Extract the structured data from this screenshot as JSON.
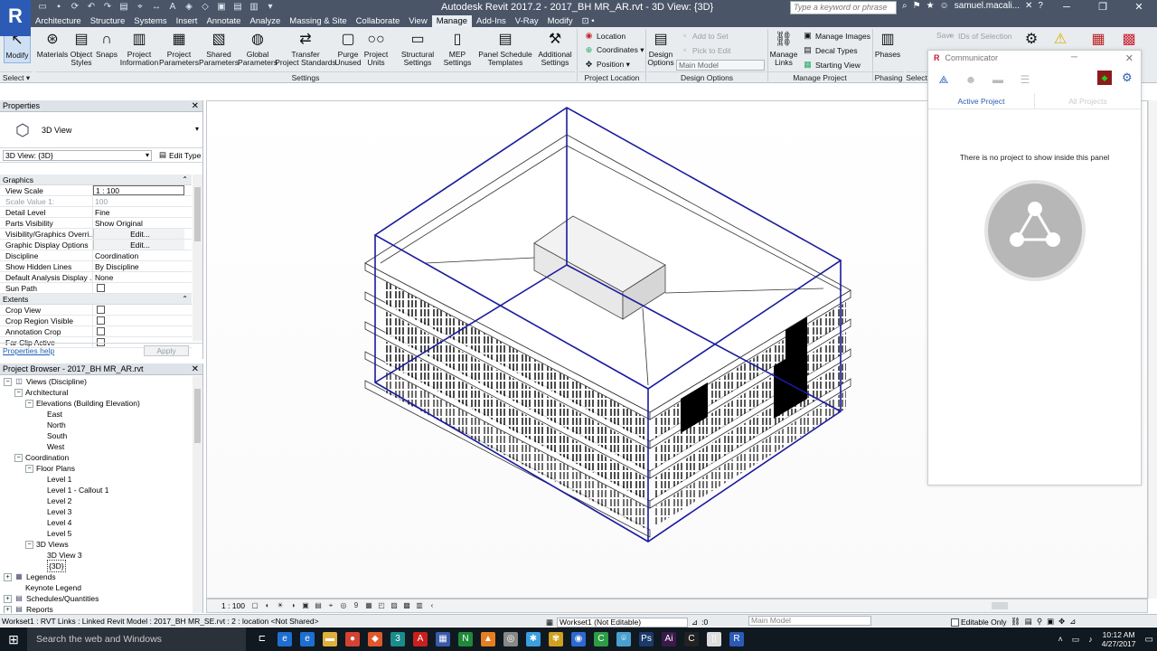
{
  "title_bar": {
    "app_logo": "R",
    "title": "Autodesk Revit 2017.2 -    2017_BH MR_AR.rvt - 3D View: {3D}",
    "search_placeholder": "Type a keyword or phrase",
    "user": "samuel.macali...",
    "help": "?",
    "minimize": "─",
    "restore": "❐",
    "close": "✕"
  },
  "ribbon_tabs": [
    "Architecture",
    "Structure",
    "Systems",
    "Insert",
    "Annotate",
    "Analyze",
    "Massing & Site",
    "Collaborate",
    "View",
    "Manage",
    "Add-Ins",
    "V-Ray",
    "Modify",
    "⊡ •"
  ],
  "active_tab": "Manage",
  "ribbon": {
    "modify": "Modify",
    "select": "Select ▾",
    "settings_buttons": [
      {
        "label": "Materials",
        "icon": "⊛"
      },
      {
        "label": "Object\nStyles",
        "icon": "▤"
      },
      {
        "label": "Snaps",
        "icon": "∩"
      },
      {
        "label": "Project\nInformation",
        "icon": "▥"
      },
      {
        "label": "Project\nParameters",
        "icon": "▦"
      },
      {
        "label": "Shared\nParameters",
        "icon": "▧"
      },
      {
        "label": "Global\nParameters",
        "icon": "◍"
      },
      {
        "label": "Transfer\nProject Standards",
        "icon": "⇄"
      },
      {
        "label": "Purge\nUnused",
        "icon": "▢"
      },
      {
        "label": "Project\nUnits",
        "icon": "○○"
      },
      {
        "label": "Structural\nSettings",
        "icon": "▭"
      },
      {
        "label": "MEP\nSettings",
        "icon": "▯"
      },
      {
        "label": "Panel Schedule\nTemplates",
        "icon": "▤"
      },
      {
        "label": "Additional\nSettings",
        "icon": "⚒"
      }
    ],
    "settings_panel": "Settings",
    "location_items": [
      "Location",
      "Coordinates ▾",
      "Position ▾"
    ],
    "location_panel": "Project Location",
    "design_options": "Design\nOptions",
    "add_to_set": "Add to Set",
    "pick_to_edit": "Pick to Edit",
    "main_model": "Main Model",
    "design_panel": "Design Options",
    "manage_links": "Manage\nLinks",
    "manage_items": [
      "Manage Images",
      "Decal Types",
      "Starting View"
    ],
    "manage_panel": "Manage Project",
    "phases": "Phases",
    "phasing_panel": "Phasing",
    "select_panel": "Select",
    "ids_of_selection": "IDs of Selection",
    "save": "Save"
  },
  "properties": {
    "header": "Properties",
    "close": "✕",
    "type_icon": "⬡",
    "type_name": "3D View",
    "instance_selector": "3D View: {3D}",
    "edit_type": "Edit Type",
    "groups": [
      {
        "name": "Graphics",
        "rows": [
          {
            "key": "View Scale",
            "value": "1 : 100",
            "style": "input"
          },
          {
            "key": "Scale Value    1:",
            "value": "100",
            "style": "disabled"
          },
          {
            "key": "Detail Level",
            "value": "Fine"
          },
          {
            "key": "Parts Visibility",
            "value": "Show Original"
          },
          {
            "key": "Visibility/Graphics Overri...",
            "value": "Edit...",
            "style": "button"
          },
          {
            "key": "Graphic Display Options",
            "value": "Edit...",
            "style": "button"
          },
          {
            "key": "Discipline",
            "value": "Coordination"
          },
          {
            "key": "Show Hidden Lines",
            "value": "By Discipline"
          },
          {
            "key": "Default Analysis Display ...",
            "value": "None"
          },
          {
            "key": "Sun Path",
            "value": "",
            "style": "checkbox"
          }
        ]
      },
      {
        "name": "Extents",
        "rows": [
          {
            "key": "Crop View",
            "value": "",
            "style": "checkbox"
          },
          {
            "key": "Crop Region Visible",
            "value": "",
            "style": "checkbox"
          },
          {
            "key": "Annotation Crop",
            "value": "",
            "style": "checkbox"
          },
          {
            "key": "Far Clip Active",
            "value": "",
            "style": "checkbox"
          }
        ]
      }
    ],
    "help_link": "Properties help",
    "apply": "Apply"
  },
  "browser": {
    "header": "Project Browser - 2017_BH MR_AR.rvt",
    "close": "✕",
    "tree": [
      {
        "label": "Views (Discipline)",
        "level": 0,
        "toggle": "−",
        "icon": "◫"
      },
      {
        "label": "Architectural",
        "level": 1,
        "toggle": "−"
      },
      {
        "label": "Elevations (Building Elevation)",
        "level": 2,
        "toggle": "−"
      },
      {
        "label": "East",
        "level": 4
      },
      {
        "label": "North",
        "level": 4
      },
      {
        "label": "South",
        "level": 4
      },
      {
        "label": "West",
        "level": 4
      },
      {
        "label": "Coordination",
        "level": 1,
        "toggle": "−"
      },
      {
        "label": "Floor Plans",
        "level": 2,
        "toggle": "−"
      },
      {
        "label": "Level 1",
        "level": 4
      },
      {
        "label": "Level 1 - Callout 1",
        "level": 4
      },
      {
        "label": "Level 2",
        "level": 4
      },
      {
        "label": "Level 3",
        "level": 4
      },
      {
        "label": "Level 4",
        "level": 4
      },
      {
        "label": "Level 5",
        "level": 4
      },
      {
        "label": "3D Views",
        "level": 2,
        "toggle": "−"
      },
      {
        "label": "3D View 3",
        "level": 4
      },
      {
        "label": "{3D}",
        "level": 4,
        "selected": true
      },
      {
        "label": "Legends",
        "level": 0,
        "toggle": "+",
        "icon": "▦"
      },
      {
        "label": "Keynote Legend",
        "level": 2
      },
      {
        "label": "Schedules/Quantities",
        "level": 0,
        "toggle": "+",
        "icon": "▤"
      },
      {
        "label": "Reports",
        "level": 0,
        "toggle": "+",
        "icon": "▤"
      }
    ]
  },
  "view_bar": {
    "scale": "1 : 100",
    "icons": [
      "▢",
      "◐",
      "☀",
      "◑",
      "▣",
      "▤",
      "⌖",
      "◎",
      "9",
      "▦",
      "◰",
      "▨",
      "▩",
      "▥",
      "‹"
    ]
  },
  "status": {
    "text": "Workset1 : RVT Links : Linked Revit Model : 2017_BH MR_SE.rvt : 2 : location <Not Shared>",
    "workset": "Workset1 (Not Editable)",
    "count": ":0",
    "design_option": "Main Model",
    "editable_only": "Editable Only"
  },
  "communicator": {
    "logo": "R",
    "title": "Communicator",
    "tabs": [
      "Active Project",
      "All Projects"
    ],
    "message": "There is no project to show inside this panel",
    "minimize": "─",
    "close": "✕"
  },
  "taskbar": {
    "search": "Search the web and Windows",
    "time": "10:12 AM",
    "date": "4/27/2017",
    "apps": [
      {
        "icon": "⊏",
        "color": "#101820"
      },
      {
        "icon": "e",
        "color": "#1e6fd0"
      },
      {
        "icon": "e",
        "color": "#1e6fd0"
      },
      {
        "icon": "▬",
        "color": "#e0b03c"
      },
      {
        "icon": "●",
        "color": "#d44332"
      },
      {
        "icon": "◆",
        "color": "#e0572e"
      },
      {
        "icon": "3",
        "color": "#1a8c8c"
      },
      {
        "icon": "A",
        "color": "#c8201e"
      },
      {
        "icon": "▦",
        "color": "#3b5aa8"
      },
      {
        "icon": "N",
        "color": "#1f8a3a"
      },
      {
        "icon": "▲",
        "color": "#e67e22"
      },
      {
        "icon": "◎",
        "color": "#888888"
      },
      {
        "icon": "✱",
        "color": "#3aa0e0"
      },
      {
        "icon": "✾",
        "color": "#d0a020"
      },
      {
        "icon": "◉",
        "color": "#2c6ad0"
      },
      {
        "icon": "C",
        "color": "#2e9c46"
      },
      {
        "icon": "⌾",
        "color": "#4aa0d0"
      },
      {
        "icon": "Ps",
        "color": "#1a3a6a"
      },
      {
        "icon": "Ai",
        "color": "#3a1a4a"
      },
      {
        "icon": "C",
        "color": "#222222"
      },
      {
        "icon": "▯",
        "color": "#dddddd"
      },
      {
        "icon": "R",
        "color": "#2c5bb6"
      }
    ]
  },
  "colors": {
    "section_box": "#1a1a9e",
    "title_bar": "#4a5568",
    "accent": "#2c5bb6"
  }
}
